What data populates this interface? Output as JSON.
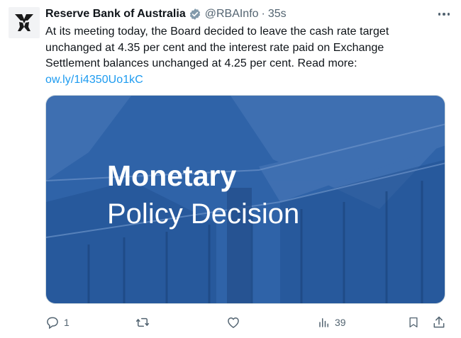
{
  "author": {
    "name": "Reserve Bank of Australia",
    "handle": "@RBAInfo",
    "separator": "·",
    "time": "35s"
  },
  "tweet": {
    "lines": [
      "At its meeting today, the Board decided to leave the cash rate target",
      "unchanged at 4.35 per cent and the interest rate paid on Exchange",
      "Settlement balances unchanged at 4.25 per cent. Read more:"
    ],
    "link": "ow.ly/1i4350Uo1kC"
  },
  "media": {
    "title": "Monetary",
    "subtitle": "Policy Decision",
    "tint": "#2f63a8"
  },
  "actions": {
    "reply_count": "1",
    "views_count": "39"
  },
  "colors": {
    "text": "#0f1419",
    "secondary": "#536471",
    "link": "#1d9bf0",
    "verified": "#829aab"
  },
  "icons": [
    "rba-logo-icon",
    "verified-badge-icon",
    "more-icon",
    "reply-icon",
    "retweet-icon",
    "like-icon",
    "views-icon",
    "bookmark-icon",
    "share-icon"
  ]
}
